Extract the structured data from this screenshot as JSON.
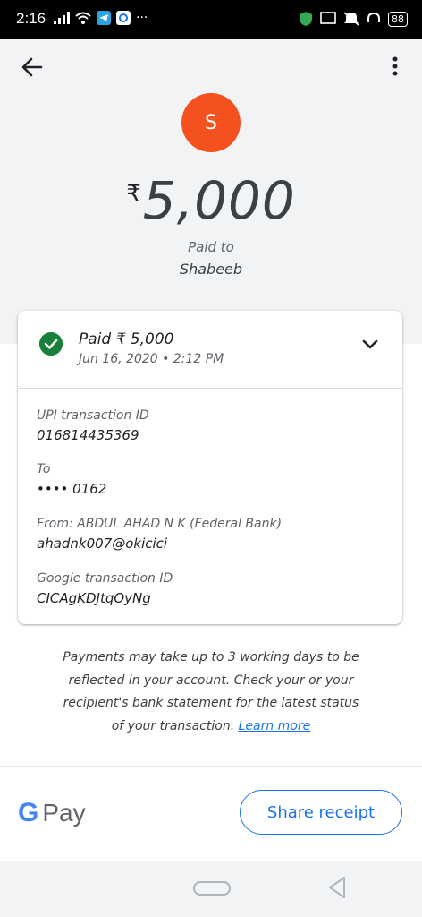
{
  "status_bar": {
    "time": "2:16",
    "battery": "88"
  },
  "payee": {
    "initial": "S",
    "name": "Shabeeb"
  },
  "amount": {
    "currency": "₹",
    "value": "5,000",
    "paid_to_label": "Paid to"
  },
  "card": {
    "status_title": "Paid ₹ 5,000",
    "date": "Jun 16, 2020 • 2:12 PM",
    "upi_label": "UPI transaction ID",
    "upi_value": "016814435369",
    "to_label": "To",
    "to_value": "•••• 0162",
    "from_label": "From: ABDUL AHAD N K (Federal Bank)",
    "from_value": "ahadnk007@okicici",
    "google_label": "Google transaction ID",
    "google_value": "CICAgKDJtqOyNg"
  },
  "note": {
    "text": "Payments may take up to 3 working days to be reflected in your account. Check your or your recipient's bank statement for the latest status of your transaction.",
    "link": "Learn more"
  },
  "footer": {
    "g_letter": "G",
    "pay": "Pay",
    "share_label": "Share receipt"
  },
  "colors": {
    "avatar": "#f4511e",
    "check": "#188038",
    "link": "#1a73e8",
    "header_bg": "#f1f3f4"
  },
  "icons": [
    "back-arrow-icon",
    "more-vert-icon",
    "check-circle-icon",
    "chevron-down-icon"
  ]
}
